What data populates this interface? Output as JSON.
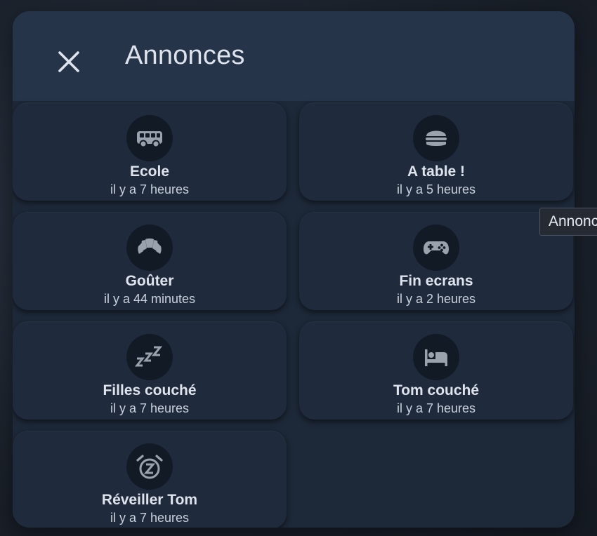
{
  "dialog": {
    "title": "Annonces",
    "close_label": "close"
  },
  "tooltip": "Annonc",
  "announcements": [
    {
      "name": "Ecole",
      "time": "il y a 7 heures",
      "icon": "bus-icon"
    },
    {
      "name": "A table !",
      "time": "il y a 5 heures",
      "icon": "hamburger-icon"
    },
    {
      "name": "Goûter",
      "time": "il y a 44 minutes",
      "icon": "croissant-icon"
    },
    {
      "name": "Fin ecrans",
      "time": "il y a 2 heures",
      "icon": "gamepad-icon"
    },
    {
      "name": "Filles couché",
      "time": "il y a 7 heures",
      "icon": "sleep-zzz-icon"
    },
    {
      "name": "Tom couché",
      "time": "il y a 7 heures",
      "icon": "bed-icon"
    },
    {
      "name": "Réveiller Tom",
      "time": "il y a 7 heures",
      "icon": "snooze-alarm-icon"
    }
  ],
  "colors": {
    "background": "#1b212b",
    "dialog": "#1d2838",
    "header": "#26344a",
    "card": "#1f2b3c",
    "icon_circle": "#121a26",
    "icon": "#9aa2ad",
    "text": "#dfe4ec"
  }
}
